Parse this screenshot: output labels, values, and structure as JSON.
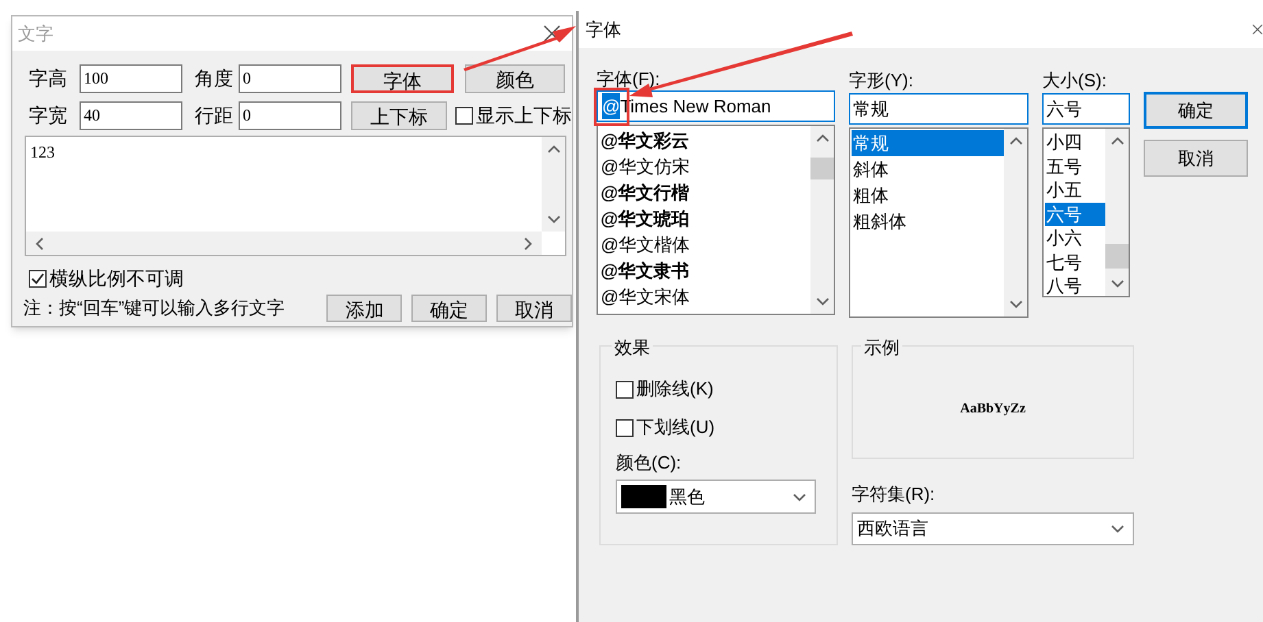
{
  "text_dialog": {
    "title": "文字",
    "fields": [
      {
        "label": "字高",
        "value": "100"
      },
      {
        "label": "角度",
        "value": "0"
      },
      {
        "label": "字宽",
        "value": "40"
      },
      {
        "label": "行距",
        "value": "0"
      }
    ],
    "top_buttons": [
      {
        "label": "字体",
        "annotated": true
      },
      {
        "label": "颜色",
        "annotated": false
      },
      {
        "label": "上下标",
        "annotated": false
      }
    ],
    "show_subscript": {
      "label": "显示上下标",
      "checked": false
    },
    "text_area": {
      "value": "123"
    },
    "lock_ratio": {
      "label": "横纵比例不可调",
      "checked": true
    },
    "note": "注：按“回车”键可以输入多行文字",
    "buttons": [
      "添加",
      "确定",
      "取消"
    ]
  },
  "font_dialog": {
    "title": "字体",
    "font": {
      "label": "字体(F):",
      "selected_text": "@",
      "text": "Times New Roman",
      "annotated": true,
      "items": [
        {
          "label": "@华文彩云",
          "bold": true,
          "selected": false
        },
        {
          "label": "@华文仿宋",
          "bold": false,
          "selected": false
        },
        {
          "label": "@华文行楷",
          "bold": true,
          "selected": false
        },
        {
          "label": "@华文琥珀",
          "bold": true,
          "selected": false
        },
        {
          "label": "@华文楷体",
          "bold": false,
          "selected": false
        },
        {
          "label": "@华文隶书",
          "bold": true,
          "selected": false
        },
        {
          "label": "@华文宋体",
          "bold": false,
          "selected": false
        }
      ]
    },
    "style": {
      "label": "字形(Y):",
      "value": "常规",
      "items": [
        {
          "label": "常规",
          "selected": true
        },
        {
          "label": "斜体",
          "selected": false
        },
        {
          "label": "粗体",
          "selected": false
        },
        {
          "label": "粗斜体",
          "selected": false
        }
      ]
    },
    "size": {
      "label": "大小(S):",
      "value": "六号",
      "items": [
        {
          "label": "小四",
          "selected": false
        },
        {
          "label": "五号",
          "selected": false
        },
        {
          "label": "小五",
          "selected": false
        },
        {
          "label": "六号",
          "selected": true
        },
        {
          "label": "小六",
          "selected": false
        },
        {
          "label": "七号",
          "selected": false
        },
        {
          "label": "八号",
          "selected": false
        }
      ]
    },
    "buttons": [
      {
        "label": "确定",
        "default": true
      },
      {
        "label": "取消",
        "default": false
      }
    ],
    "effects": {
      "title": "效果",
      "options": [
        {
          "label": "删除线(K)",
          "checked": false
        },
        {
          "label": "下划线(U)",
          "checked": false
        }
      ],
      "color_label": "颜色(C):",
      "color": {
        "name": "黑色"
      }
    },
    "sample": {
      "title": "示例",
      "text": "AaBbYyZz"
    },
    "charset": {
      "label": "字符集(R):",
      "value": "西欧语言"
    }
  }
}
